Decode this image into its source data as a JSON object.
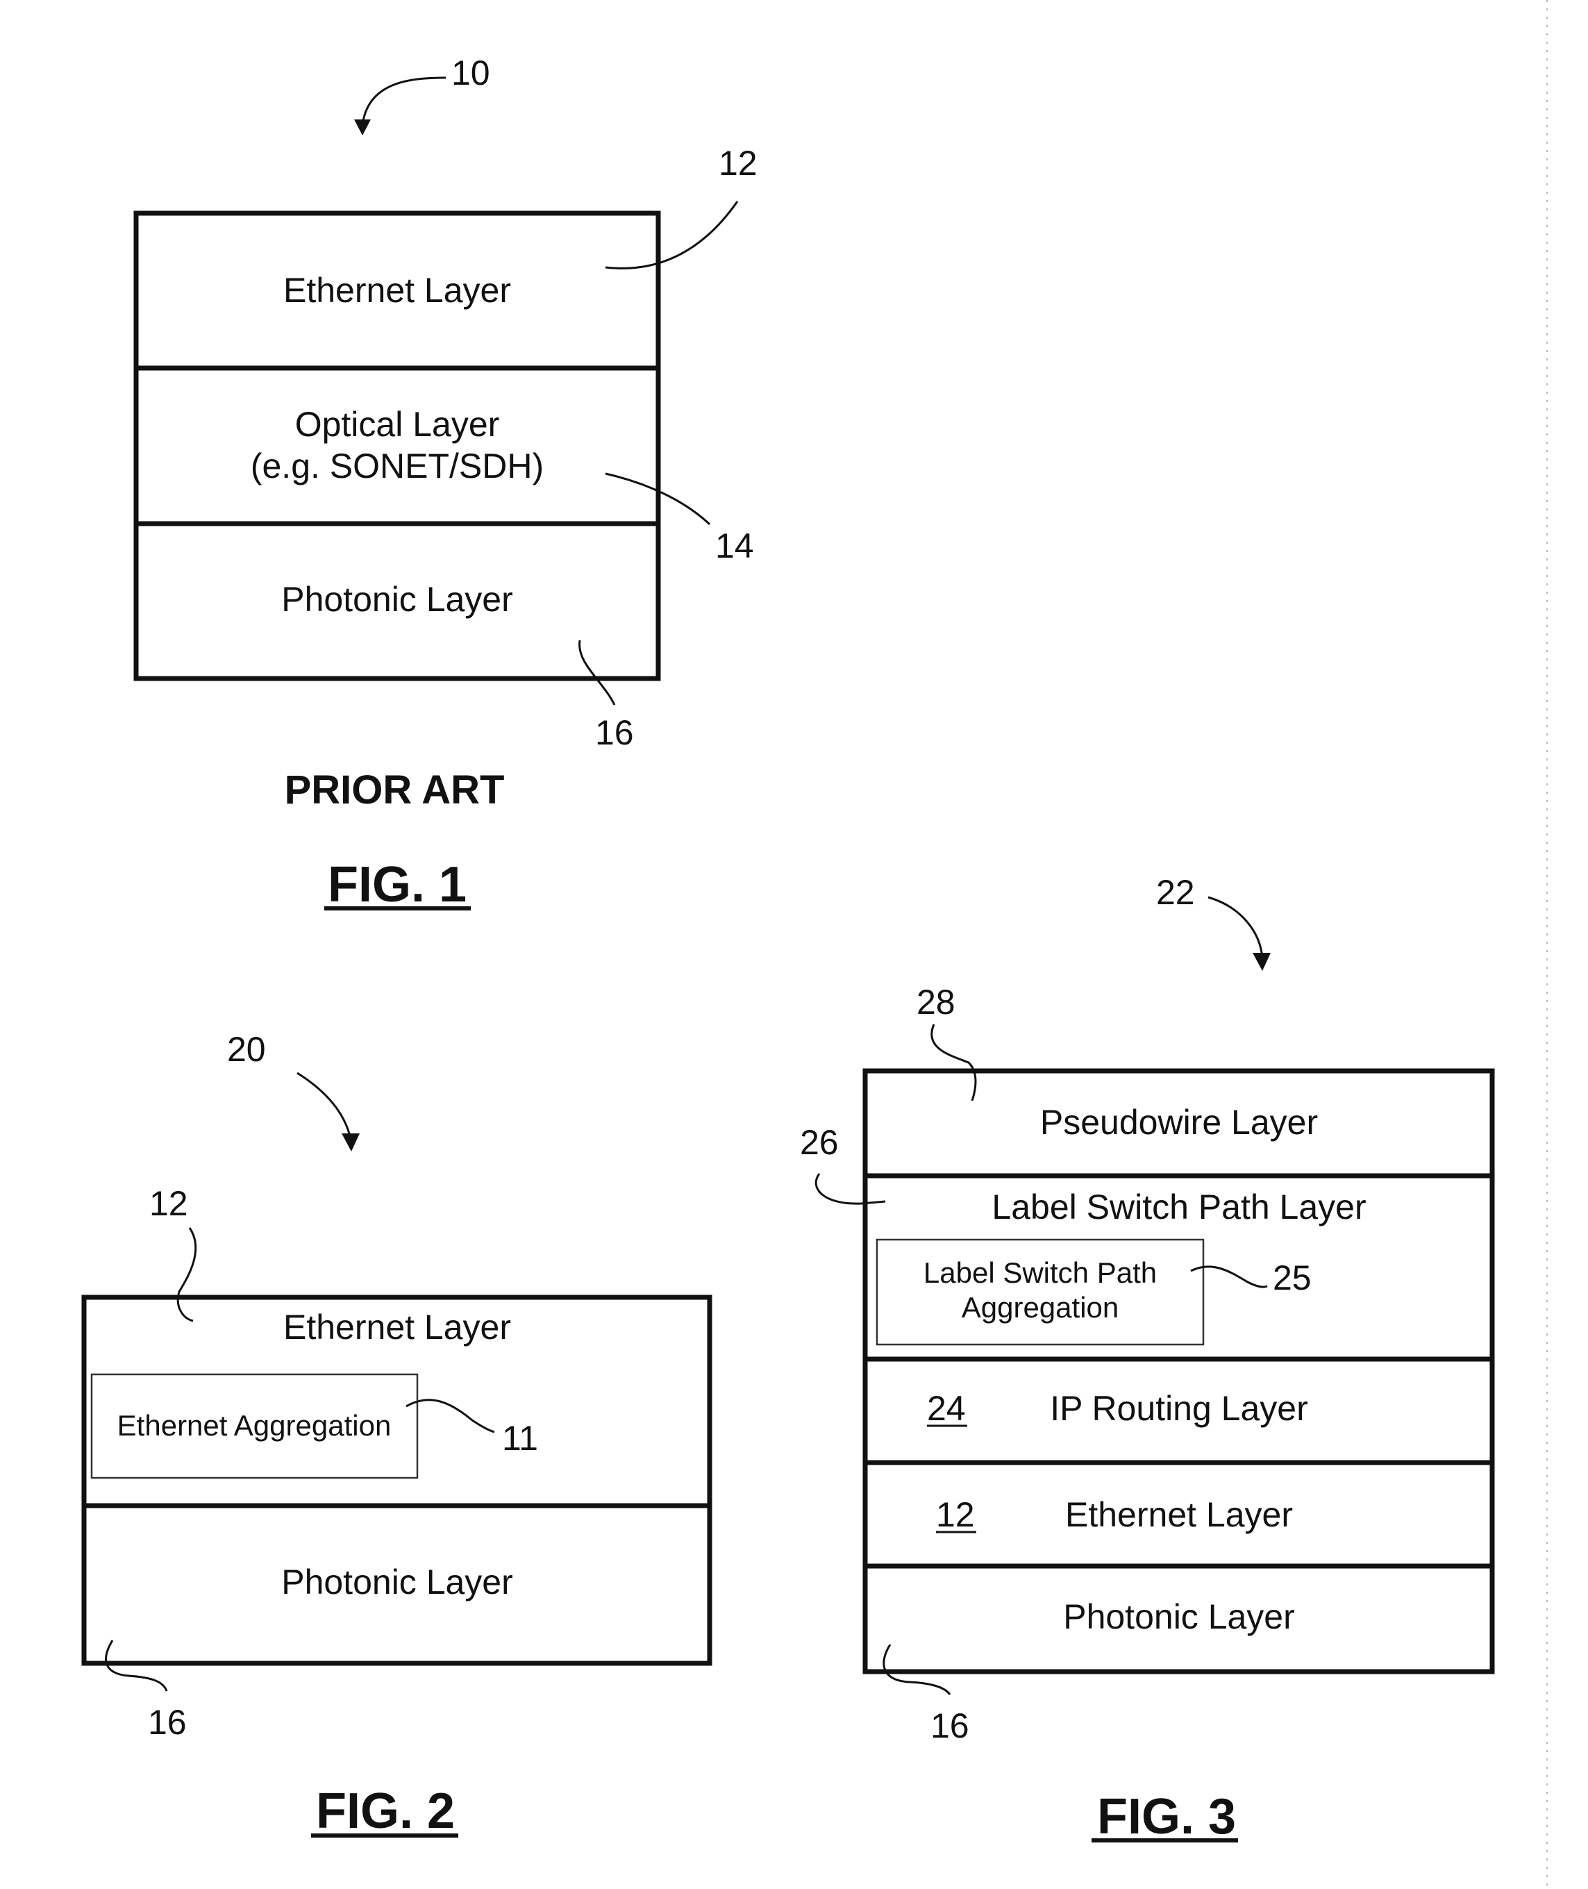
{
  "fig1": {
    "ref_main": "10",
    "layers": [
      {
        "label": "Ethernet Layer",
        "ref": "12"
      },
      {
        "label": "Optical Layer",
        "label2": "(e.g. SONET/SDH)",
        "ref": "14"
      },
      {
        "label": "Photonic Layer",
        "ref": "16"
      }
    ],
    "note": "PRIOR ART",
    "caption": "FIG. 1"
  },
  "fig2": {
    "ref_main": "20",
    "layers": [
      {
        "label": "Ethernet Layer",
        "ref": "12"
      },
      {
        "label": "Photonic Layer",
        "ref": "16"
      }
    ],
    "inner_box": {
      "label": "Ethernet Aggregation",
      "ref": "11"
    },
    "caption": "FIG. 2"
  },
  "fig3": {
    "ref_main": "22",
    "layers": [
      {
        "label": "Pseudowire Layer",
        "ref": "28"
      },
      {
        "label": "Label Switch Path Layer",
        "ref": "26"
      },
      {
        "label": "IP Routing Layer",
        "ref": "24"
      },
      {
        "label": "Ethernet Layer",
        "ref": "12"
      },
      {
        "label": "Photonic Layer",
        "ref": "16"
      }
    ],
    "inner_box": {
      "label": "Label Switch Path",
      "label2": "Aggregation",
      "ref": "25"
    },
    "caption": "FIG. 3"
  }
}
